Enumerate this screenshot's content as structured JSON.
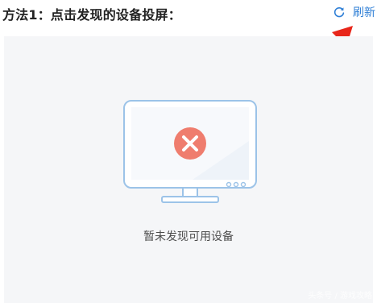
{
  "header": {
    "title": "方法1：点击发现的设备投屏：",
    "refresh_label": "刷新",
    "refresh_icon": "refresh-icon"
  },
  "empty_state": {
    "icon": "monitor-error-icon",
    "message": "暂未发现可用设备"
  },
  "watermark": "头条号 / 游戏攻略",
  "colors": {
    "accent": "#2f7fd6",
    "error": "#ef7d6e",
    "arrow": "#e8261a",
    "panel_background": "#f5f6f8"
  }
}
